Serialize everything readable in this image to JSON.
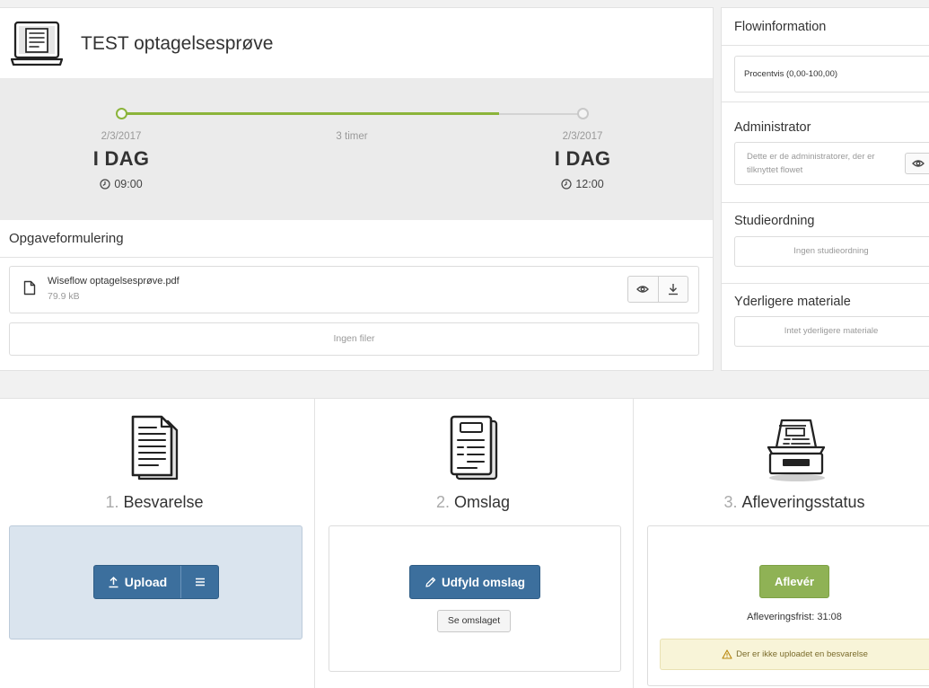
{
  "header": {
    "title": "TEST optagelsesprøve",
    "icon": "laptop-icon"
  },
  "timeline": {
    "start": {
      "date": "2/3/2017",
      "day": "I DAG",
      "time": "09:00"
    },
    "duration": "3 timer",
    "end": {
      "date": "2/3/2017",
      "day": "I DAG",
      "time": "12:00"
    },
    "progress": 0.82
  },
  "assignment": {
    "heading": "Opgaveformulering",
    "file": {
      "name": "Wiseflow optagelsesprøve.pdf",
      "size": "79.9 kB",
      "icon": "file-icon"
    },
    "empty_text": "Ingen filer"
  },
  "flowinfo": {
    "heading": "Flowinformation",
    "grading": "Procentvis (0,00-100,00)",
    "administrator": {
      "heading": "Administrator",
      "text": "Dette er de administratorer, der er tilknyttet flowet"
    },
    "studieordning": {
      "heading": "Studieordning",
      "text": "Ingen studieordning"
    },
    "material": {
      "heading": "Yderligere materiale",
      "text": "Intet yderligere materiale"
    }
  },
  "steps": {
    "answer": {
      "number": "1.",
      "title": "Besvarelse",
      "upload_label": "Upload",
      "icon": "document-icon"
    },
    "cover": {
      "number": "2.",
      "title": "Omslag",
      "fill_label": "Udfyld omslag",
      "view_label": "Se omslaget",
      "icon": "cover-page-icon"
    },
    "status": {
      "number": "3.",
      "title": "Afleveringsstatus",
      "submit_label": "Aflevér",
      "deadline": "Afleveringsfrist: 31:08",
      "warning": "Der er ikke uploadet en besvarelse",
      "icon": "inbox-tray-icon"
    }
  },
  "colors": {
    "progress_green": "#8bb43a",
    "primary_blue": "#3c6f9d",
    "submit_green": "#8fb255",
    "warning_bg": "#f8f4d8"
  }
}
